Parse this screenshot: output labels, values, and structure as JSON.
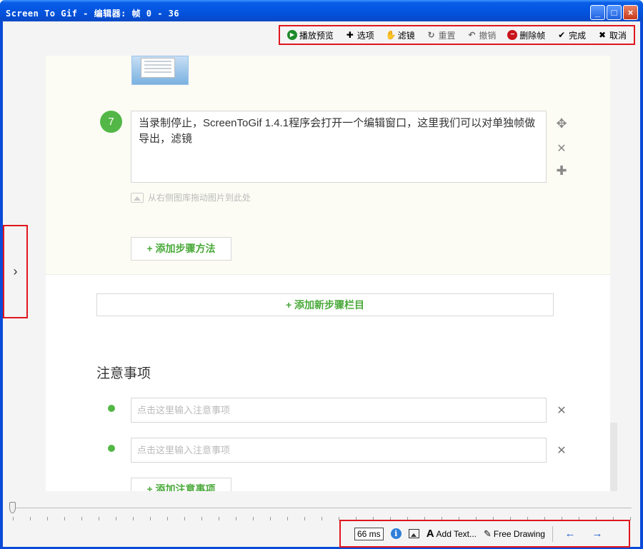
{
  "window": {
    "title": "Screen To Gif - 编辑器: 帧 0 - 36",
    "controls": {
      "minimize": "_",
      "maximize": "□",
      "close": "×"
    }
  },
  "toolbar": {
    "items": [
      {
        "label": "播放预览",
        "icon": "play-icon",
        "glyph": "▶"
      },
      {
        "label": "选项",
        "icon": "plus-icon",
        "glyph": "✚"
      },
      {
        "label": "滤镜",
        "icon": "hand-icon",
        "glyph": "✋"
      },
      {
        "label": "重置",
        "icon": "reset-icon",
        "glyph": "↻"
      },
      {
        "label": "撤销",
        "icon": "undo-icon",
        "glyph": "↶"
      },
      {
        "label": "删除帧",
        "icon": "delete-icon",
        "glyph": "−"
      },
      {
        "label": "完成",
        "icon": "check-icon",
        "glyph": "✔"
      },
      {
        "label": "取消",
        "icon": "cancel-icon",
        "glyph": "✖"
      }
    ]
  },
  "sidebar_toggle": {
    "glyph": "›"
  },
  "editor": {
    "step_number": "7",
    "step_text": "当录制停止，ScreenToGif 1.4.1程序会打开一个编辑窗口，这里我们可以对单独帧做导出，滤镜",
    "step_tools": {
      "move": "✥",
      "remove": "✕",
      "add": "✚"
    },
    "drop_hint": "从右侧图库拖动图片到此处",
    "add_method_button": "+ 添加步骤方法",
    "add_section_button": "+ 添加新步骤栏目",
    "notes_title": "注意事项",
    "notes": [
      {
        "placeholder": "点击这里输入注意事项"
      },
      {
        "placeholder": "点击这里输入注意事项"
      }
    ],
    "add_note_button": "+ 添加注意事项",
    "remove_glyph": "✕"
  },
  "bottombar": {
    "delay": "66 ms",
    "info_glyph": "i",
    "text_glyph": "A",
    "add_text": "Add Text...",
    "draw_glyph": "✎",
    "free_drawing": "Free Drawing",
    "prev_glyph": "←",
    "next_glyph": "→"
  },
  "colors": {
    "titlebar": "#0457e3",
    "highlight_border": "#e0161d",
    "accent_green": "#53b747",
    "link_blue": "#1757c9"
  }
}
